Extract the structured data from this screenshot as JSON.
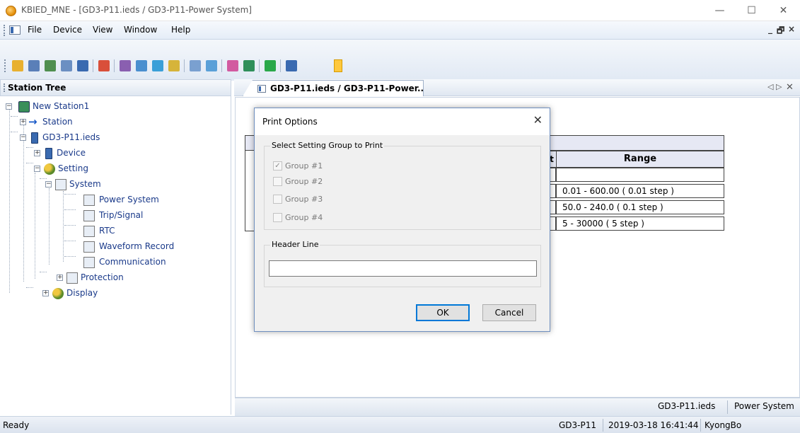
{
  "window": {
    "title": "KBIED_MNE - [GD3-P11.ieds / GD3-P11-Power System]",
    "minimize": "—",
    "maximize": "☐",
    "close": "✕"
  },
  "menu": {
    "items": [
      "File",
      "Device",
      "View",
      "Window",
      "Help"
    ],
    "mdi_min": "_",
    "mdi_restore": "🗗",
    "mdi_close": "×"
  },
  "toolbar": {
    "colors": [
      "#e8b030",
      "#5a7fb8",
      "#4f8f4f",
      "#6b8fc2",
      "#3a6ab0",
      "#d94f3a",
      "#8a5fb0",
      "#4a8fcf",
      "#3a9fd8",
      "#d6b43a",
      "#7aa0d0",
      "#5aa0d8",
      "#d25aa0",
      "#2f8f5a",
      "#2aa84a",
      "#3a6ab0"
    ]
  },
  "station_tree": {
    "title": "Station Tree",
    "nodes": {
      "root": "New Station1",
      "station": "Station",
      "ieds": "GD3-P11.ieds",
      "device": "Device",
      "setting": "Setting",
      "system": "System",
      "power_system": "Power System",
      "trip_signal": "Trip/Signal",
      "rtc": "RTC",
      "waveform": "Waveform Record",
      "communication": "Communication",
      "protection": "Protection",
      "display": "Display"
    }
  },
  "doc_tab": {
    "label": "GD3-P11.ieds / GD3-P11-Power...",
    "nav_left": "◁",
    "nav_right": "▷",
    "close": "✕"
  },
  "table": {
    "unit_header": "it",
    "range_header": "Range",
    "units": [
      "]",
      "]",
      "",
      ""
    ],
    "ranges": [
      "",
      "0.01 - 600.00 ( 0.01 step )",
      "50.0 - 240.0 ( 0.1 step )",
      "5 - 30000 ( 5 step )"
    ]
  },
  "dialog": {
    "title": "Print Options",
    "close": "✕",
    "group_box_title": "Select Setting Group to Print",
    "groups": [
      {
        "label": "Group #1",
        "checked": true
      },
      {
        "label": "Group #2",
        "checked": false
      },
      {
        "label": "Group #3",
        "checked": false
      },
      {
        "label": "Group #4",
        "checked": false
      }
    ],
    "header_box_title": "Header Line",
    "header_value": "",
    "ok": "OK",
    "cancel": "Cancel"
  },
  "doc_status": {
    "file": "GD3-P11.ieds",
    "view": "Power System"
  },
  "status_bar": {
    "left": "Ready",
    "device": "GD3-P11",
    "datetime": "2019-03-18 16:41:44",
    "user": "KyongBo"
  }
}
